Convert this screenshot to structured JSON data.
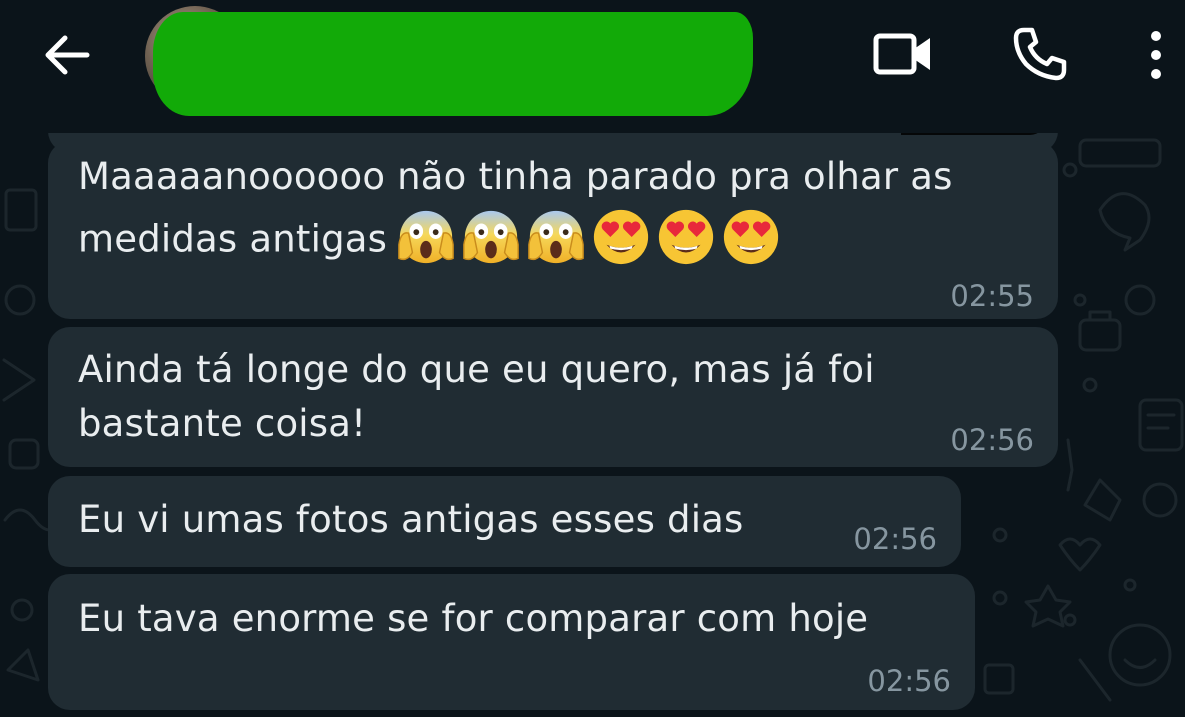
{
  "header": {
    "contact_name": "",
    "icons": [
      "arrow-left-icon",
      "avatar",
      "video-camera-icon",
      "phone-icon",
      "three-dots-vertical-icon"
    ]
  },
  "messages": [
    {
      "line1": "Maaaaanoooooo não tinha parado pra olhar as",
      "line2": "medidas antigas",
      "emojis": [
        "face-screaming-in-fear",
        "face-screaming-in-fear",
        "face-screaming-in-fear",
        "smiling-face-with-heart-eyes",
        "smiling-face-with-heart-eyes",
        "smiling-face-with-heart-eyes"
      ],
      "time": "02:55"
    },
    {
      "line1": "Ainda tá longe do que eu quero, mas já foi",
      "line2": "bastante coisa!",
      "time": "02:56"
    },
    {
      "line1": "Eu vi umas fotos antigas esses dias",
      "time": "02:56"
    },
    {
      "line1": "Eu tava enorme se for comparar com hoje",
      "time": "02:56"
    }
  ],
  "colors": {
    "background": "#0b141a",
    "bubble": "#202c33",
    "text": "#e9edef",
    "timestamp": "#8696a0",
    "redaction": "#12aa08"
  }
}
